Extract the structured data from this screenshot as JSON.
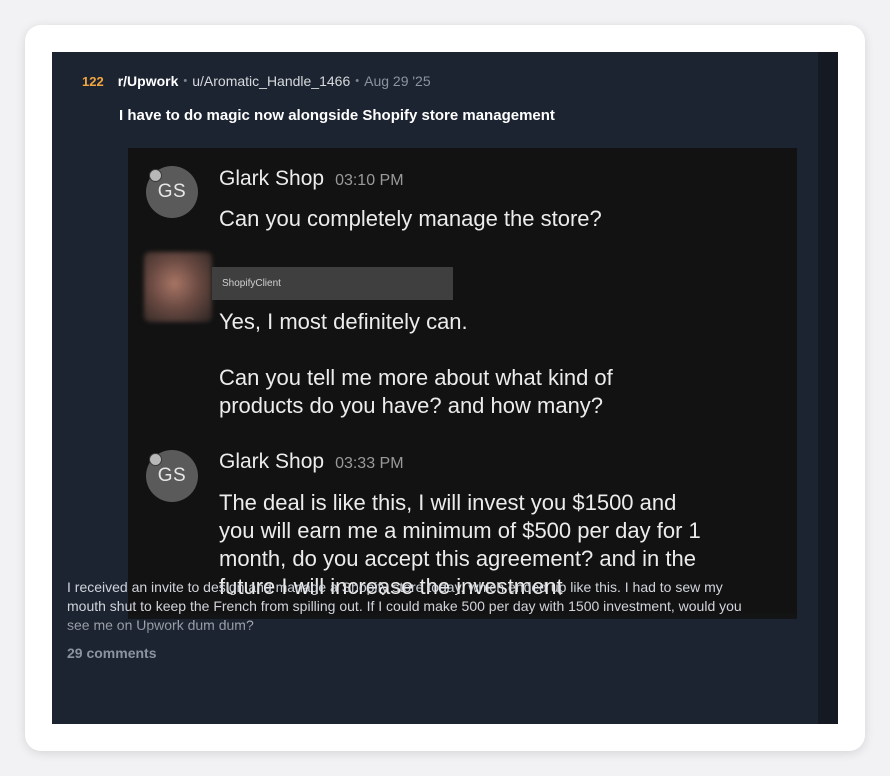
{
  "post": {
    "score": "122",
    "subreddit": "r/Upwork",
    "separator": "•",
    "author": "u/Aromatic_Handle_1466",
    "date": "Aug 29 '25",
    "title": "I have to do magic now alongside Shopify store management",
    "body": "I received an invite to design and manage a Shopify store today, which ended up like this. I had to sew my mouth shut to keep the French from spilling out. If I could make 500 per day with 1500 investment, would you see me on Upwork dum dum?",
    "comments": "29 comments"
  },
  "chat": {
    "messages": [
      {
        "avatar_initials": "GS",
        "sender": "Glark Shop",
        "time": "03:10 PM",
        "text": "Can you completely manage the store?"
      },
      {
        "redacted_label": "ShopifyClient",
        "text": "Yes, I most definitely can.\n\nCan you tell me more about what kind of\nproducts do you have? and how many?"
      },
      {
        "avatar_initials": "GS",
        "sender": "Glark Shop",
        "time": "03:33 PM",
        "text": "The deal is like this, I will invest you $1500 and\nyou will earn me a minimum of $500 per day for 1\nmonth, do you accept this agreement? and in the\nfuture I will increase the investment"
      }
    ]
  },
  "colors": {
    "score": "#f2a640",
    "post_background": "#1c2331",
    "chat_background": "#121212"
  }
}
